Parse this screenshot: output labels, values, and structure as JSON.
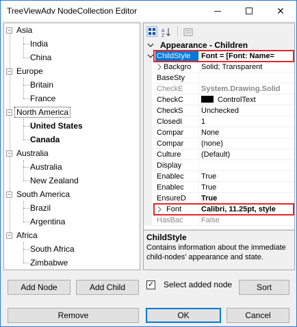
{
  "window": {
    "title": "TreeViewAdv NodeCollection Editor",
    "minimize_glyph": "",
    "close_glyph": "✕"
  },
  "tree": {
    "nodes": [
      {
        "label": "Asia",
        "children": [
          "India",
          "China"
        ]
      },
      {
        "label": "Europe",
        "children": [
          "Britain",
          "France"
        ]
      },
      {
        "label": "North America",
        "children": [
          "United States",
          "Canada"
        ]
      },
      {
        "label": "Australia",
        "children": [
          "Australia",
          "New Zealand"
        ]
      },
      {
        "label": "South America",
        "children": [
          "Brazil",
          "Argentina"
        ]
      },
      {
        "label": "Africa",
        "children": [
          "South Africa",
          "Zimbabwe"
        ]
      }
    ],
    "expander_glyph": "−"
  },
  "property_grid": {
    "toolbar": {
      "categorized_icon": "categorized-icon",
      "alphabetical_icon": "alphabetical-icon",
      "property_pages_icon": "property-pages-icon"
    },
    "category_label": "Appearance - Children",
    "rows": [
      {
        "name": "ChildStyle",
        "value": "Font = [Font: Name="
      },
      {
        "name": "Backgro",
        "value": "Solid; Transparent"
      },
      {
        "name": "BaseSty",
        "value": ""
      },
      {
        "name": "CheckE",
        "value": "System.Drawing.Solid"
      },
      {
        "name": "CheckC",
        "value": "ControlText"
      },
      {
        "name": "CheckS",
        "value": "Unchecked"
      },
      {
        "name": "ClosedI",
        "value": "1"
      },
      {
        "name": "Compar",
        "value": "None"
      },
      {
        "name": "Compar",
        "value": "(none)"
      },
      {
        "name": "Culture",
        "value": "(Default)"
      },
      {
        "name": "Display",
        "value": ""
      },
      {
        "name": "Enablec",
        "value": "True"
      },
      {
        "name": "Enablec",
        "value": "True"
      },
      {
        "name": "EnsureD",
        "value": "True"
      },
      {
        "name": "Font",
        "value": "Calibri, 11.25pt, style"
      },
      {
        "name": "HasBac",
        "value": "False"
      }
    ],
    "description": {
      "title": "ChildStyle",
      "text": "Contains information about the immediate child-nodes' appearance and state."
    }
  },
  "buttons": {
    "add_node": "Add Node",
    "add_child": "Add Child",
    "select_added_node": "Select added node",
    "sort": "Sort",
    "remove": "Remove",
    "ok": "OK",
    "cancel": "Cancel"
  },
  "colors": {
    "selection": "#0078d7",
    "highlight_box": "#e0262a"
  }
}
